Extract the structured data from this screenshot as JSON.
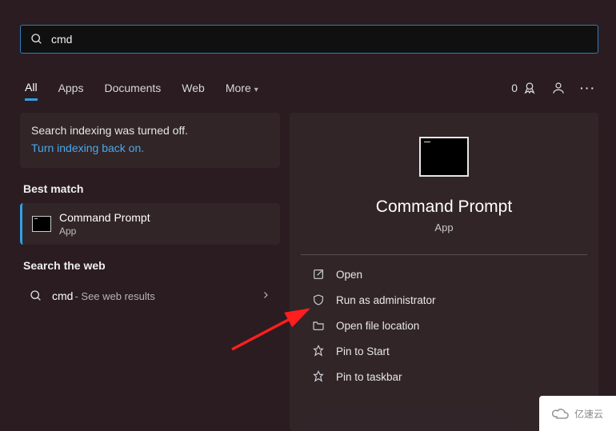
{
  "search": {
    "query": "cmd"
  },
  "tabs": {
    "items": [
      "All",
      "Apps",
      "Documents",
      "Web",
      "More"
    ],
    "active": 0
  },
  "rewards": {
    "count": "0"
  },
  "indexing": {
    "message": "Search indexing was turned off.",
    "link": "Turn indexing back on."
  },
  "sections": {
    "best_match": "Best match",
    "search_web": "Search the web"
  },
  "best_match": {
    "title": "Command Prompt",
    "subtitle": "App"
  },
  "web_result": {
    "query": "cmd",
    "suffix": " - See web results"
  },
  "preview": {
    "title": "Command Prompt",
    "subtitle": "App",
    "actions": {
      "open": "Open",
      "run_admin": "Run as administrator",
      "open_loc": "Open file location",
      "pin_start": "Pin to Start",
      "pin_taskbar": "Pin to taskbar"
    }
  },
  "watermark": "亿速云"
}
